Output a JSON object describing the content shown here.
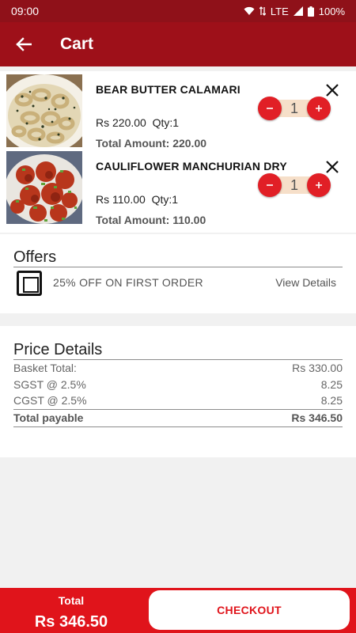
{
  "status_bar": {
    "time": "09:00",
    "network": "LTE",
    "battery": "100%"
  },
  "app_bar": {
    "title": "Cart"
  },
  "cart": {
    "items": [
      {
        "name": "BEAR BUTTER CALAMARI",
        "price": "Rs 220.00",
        "qty_label": "Qty:1",
        "total": "Total Amount: 220.00",
        "quantity": "1",
        "image": "calamari-photo"
      },
      {
        "name": "CAULIFLOWER MANCHURIAN DRY",
        "price": "Rs 110.00",
        "qty_label": "Qty:1",
        "total": "Total Amount: 110.00",
        "quantity": "1",
        "image": "manchurian-photo"
      }
    ]
  },
  "offers": {
    "title": "Offers",
    "text": "25% OFF ON FIRST ORDER",
    "link": "View Details"
  },
  "price_details": {
    "title": "Price Details",
    "rows": [
      {
        "label": "Basket Total:",
        "value": "Rs 330.00"
      },
      {
        "label": "SGST @ 2.5%",
        "value": "8.25"
      },
      {
        "label": "CGST @ 2.5%",
        "value": "8.25"
      }
    ],
    "total": {
      "label": "Total payable",
      "value": "Rs 346.50"
    }
  },
  "bottom_bar": {
    "total_label": "Total",
    "total_value": "Rs 346.50",
    "checkout_label": "CHECKOUT"
  },
  "colors": {
    "header": "#9e1019",
    "status_bar": "#8f1119",
    "accent": "#e0141b",
    "stepper_bg": "#f6dfc9"
  }
}
